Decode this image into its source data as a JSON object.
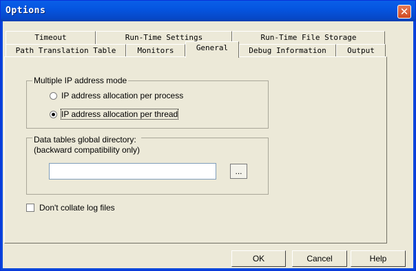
{
  "window": {
    "title": "Options",
    "close_glyph": "✕"
  },
  "tabs": {
    "row_back": [
      "Timeout",
      "Run-Time Settings",
      "Run-Time File Storage"
    ],
    "row_front": [
      "Path Translation Table",
      "Monitors",
      "General",
      "Debug Information",
      "Output"
    ],
    "active": "General"
  },
  "general": {
    "ip_mode": {
      "legend": "Multiple IP address mode",
      "options": [
        "IP address allocation per process",
        "IP address allocation per thread"
      ],
      "selected": "IP address allocation per thread"
    },
    "data_tables": {
      "legend_line1": "Data tables global directory:",
      "legend_line2": "(backward compatibility only)",
      "path_value": "",
      "browse_label": "..."
    },
    "collate": {
      "label": "Don't collate log files",
      "checked": false
    }
  },
  "buttons": {
    "ok": "OK",
    "cancel": "Cancel",
    "help": "Help"
  },
  "icons": {
    "close": "close-icon"
  }
}
